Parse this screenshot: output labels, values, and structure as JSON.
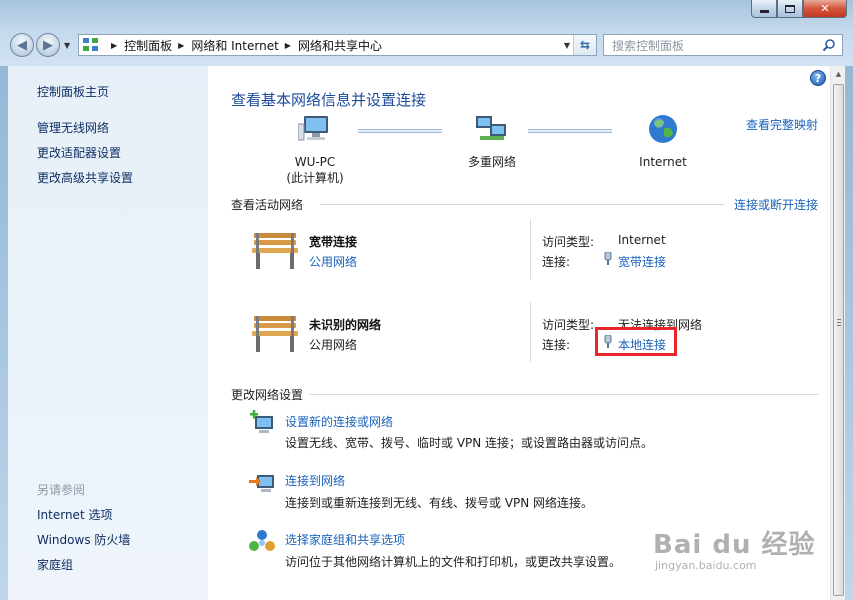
{
  "navigation": {
    "breadcrumbs": [
      "控制面板",
      "网络和 Internet",
      "网络和共享中心"
    ],
    "search_placeholder": "搜索控制面板"
  },
  "sidebar": {
    "home": "控制面板主页",
    "links": [
      "管理无线网络",
      "更改适配器设置",
      "更改高级共享设置"
    ],
    "see_also_heading": "另请参阅",
    "see_also": [
      "Internet 选项",
      "Windows 防火墙",
      "家庭组"
    ]
  },
  "main": {
    "title": "查看基本网络信息并设置连接",
    "full_map_link": "查看完整映射",
    "map_nodes": {
      "computer": {
        "name": "WU-PC",
        "sub": "(此计算机)"
      },
      "network": {
        "name": "多重网络"
      },
      "internet": {
        "name": "Internet"
      }
    },
    "active_networks": {
      "heading": "查看活动网络",
      "toggle_link": "连接或断开连接",
      "access_type_label": "访问类型:",
      "connection_label": "连接:",
      "networks": [
        {
          "name": "宽带连接",
          "type": "公用网络",
          "access_type": "Internet",
          "connection": "宽带连接"
        },
        {
          "name": "未识别的网络",
          "type": "公用网络",
          "access_type": "无法连接到网络",
          "connection": "本地连接"
        }
      ]
    },
    "change_settings": {
      "heading": "更改网络设置",
      "tasks": [
        {
          "title": "设置新的连接或网络",
          "desc": "设置无线、宽带、拨号、临时或 VPN 连接；或设置路由器或访问点。"
        },
        {
          "title": "连接到网络",
          "desc": "连接到或重新连接到无线、有线、拨号或 VPN 网络连接。"
        },
        {
          "title": "选择家庭组和共享选项",
          "desc": "访问位于其他网络计算机上的文件和打印机，或更改共享设置。"
        }
      ]
    }
  },
  "watermark": {
    "main": "Bai du 经验",
    "sub": "jingyan.baidu.com"
  },
  "colors": {
    "link": "#1a62bb",
    "title": "#1c4b9b",
    "highlight": "#e8262c",
    "sidebar_bg": "#e7f0f8"
  }
}
